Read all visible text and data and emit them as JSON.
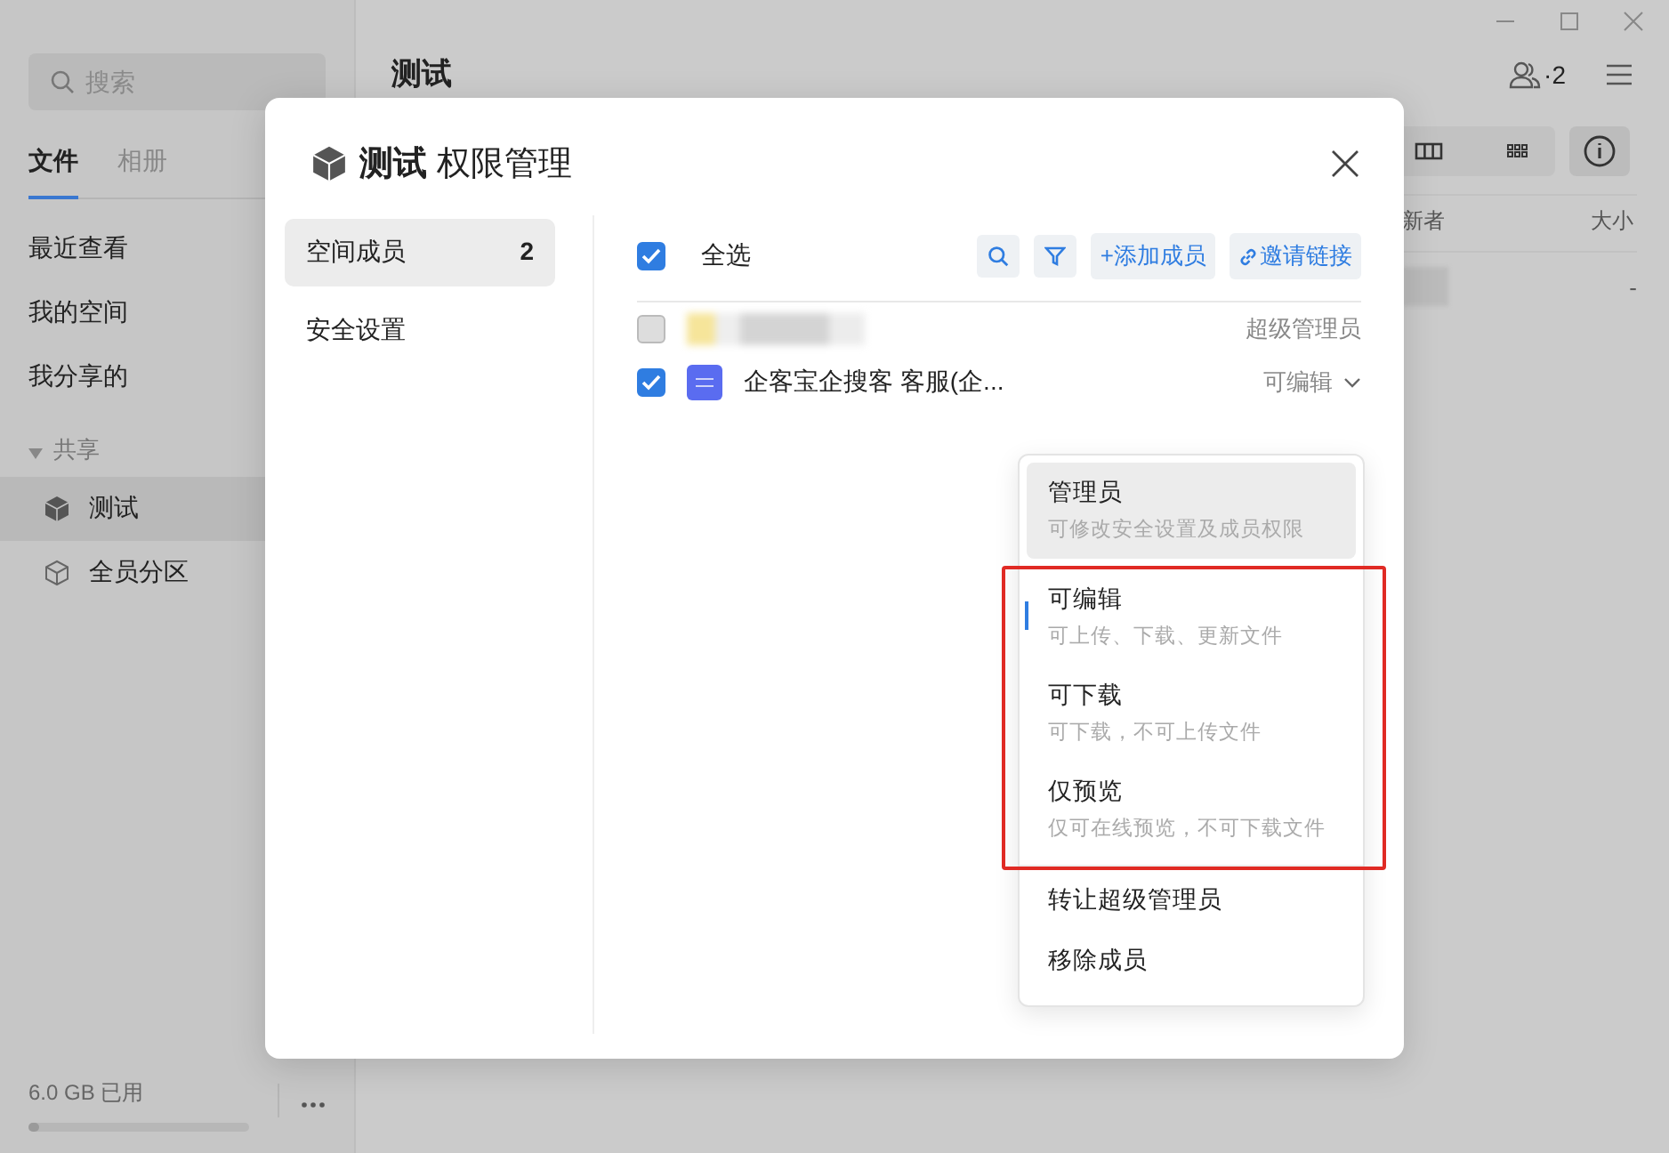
{
  "sidebar": {
    "search": {
      "placeholder": "搜索"
    },
    "tabs": [
      {
        "label": "文件",
        "selected": true
      },
      {
        "label": "相册",
        "selected": false
      }
    ],
    "nav": [
      {
        "label": "最近查看"
      },
      {
        "label": "我的空间"
      },
      {
        "label": "我分享的"
      }
    ],
    "section": {
      "label": "共享",
      "expanded": true,
      "children": [
        {
          "label": "测试",
          "selected": true,
          "kind": "filled"
        },
        {
          "label": "全员分区",
          "selected": false,
          "kind": "outline"
        }
      ]
    },
    "storage": {
      "text": "6.0 GB 已用",
      "level": 0.05
    }
  },
  "main": {
    "title": "测试",
    "members": "·2",
    "columns": [
      "新者",
      "大小"
    ],
    "rows": [
      {
        "size": "-"
      }
    ]
  },
  "dialog": {
    "title_bold": "测试",
    "title": "权限管理",
    "nav": [
      {
        "label": "空间成员",
        "count": "2",
        "selected": true
      },
      {
        "label": "安全设置",
        "selected": false
      }
    ],
    "select_all": {
      "label": "全选",
      "checked": true
    },
    "actions": [
      {
        "kind": "add",
        "label": "+添加成员"
      },
      {
        "kind": "link",
        "label": "邀请链接"
      }
    ],
    "members": [
      {
        "kind": "blurred",
        "checked": false,
        "disabled": true,
        "role": "超级管理员",
        "dropdown": false
      },
      {
        "kind": "named",
        "name": "企客宝企搜客 客服(企...",
        "checked": true,
        "disabled": false,
        "role": "可编辑",
        "dropdown": true
      }
    ]
  },
  "menu": {
    "roles": [
      {
        "label": "管理员",
        "desc": "可修改安全设置及成员权限",
        "selected": false,
        "hovered": true
      }
    ],
    "highlighted_roles": [
      {
        "label": "可编辑",
        "desc": "可上传、下载、更新文件",
        "selected": true,
        "hovered": false
      },
      {
        "label": "可下载",
        "desc": "可下载，不可上传文件",
        "selected": false,
        "hovered": false
      },
      {
        "label": "仅预览",
        "desc": "仅可在线预览，不可下载文件",
        "selected": false,
        "hovered": false
      }
    ],
    "actions": [
      "转让超级管理员",
      "移除成员"
    ]
  }
}
